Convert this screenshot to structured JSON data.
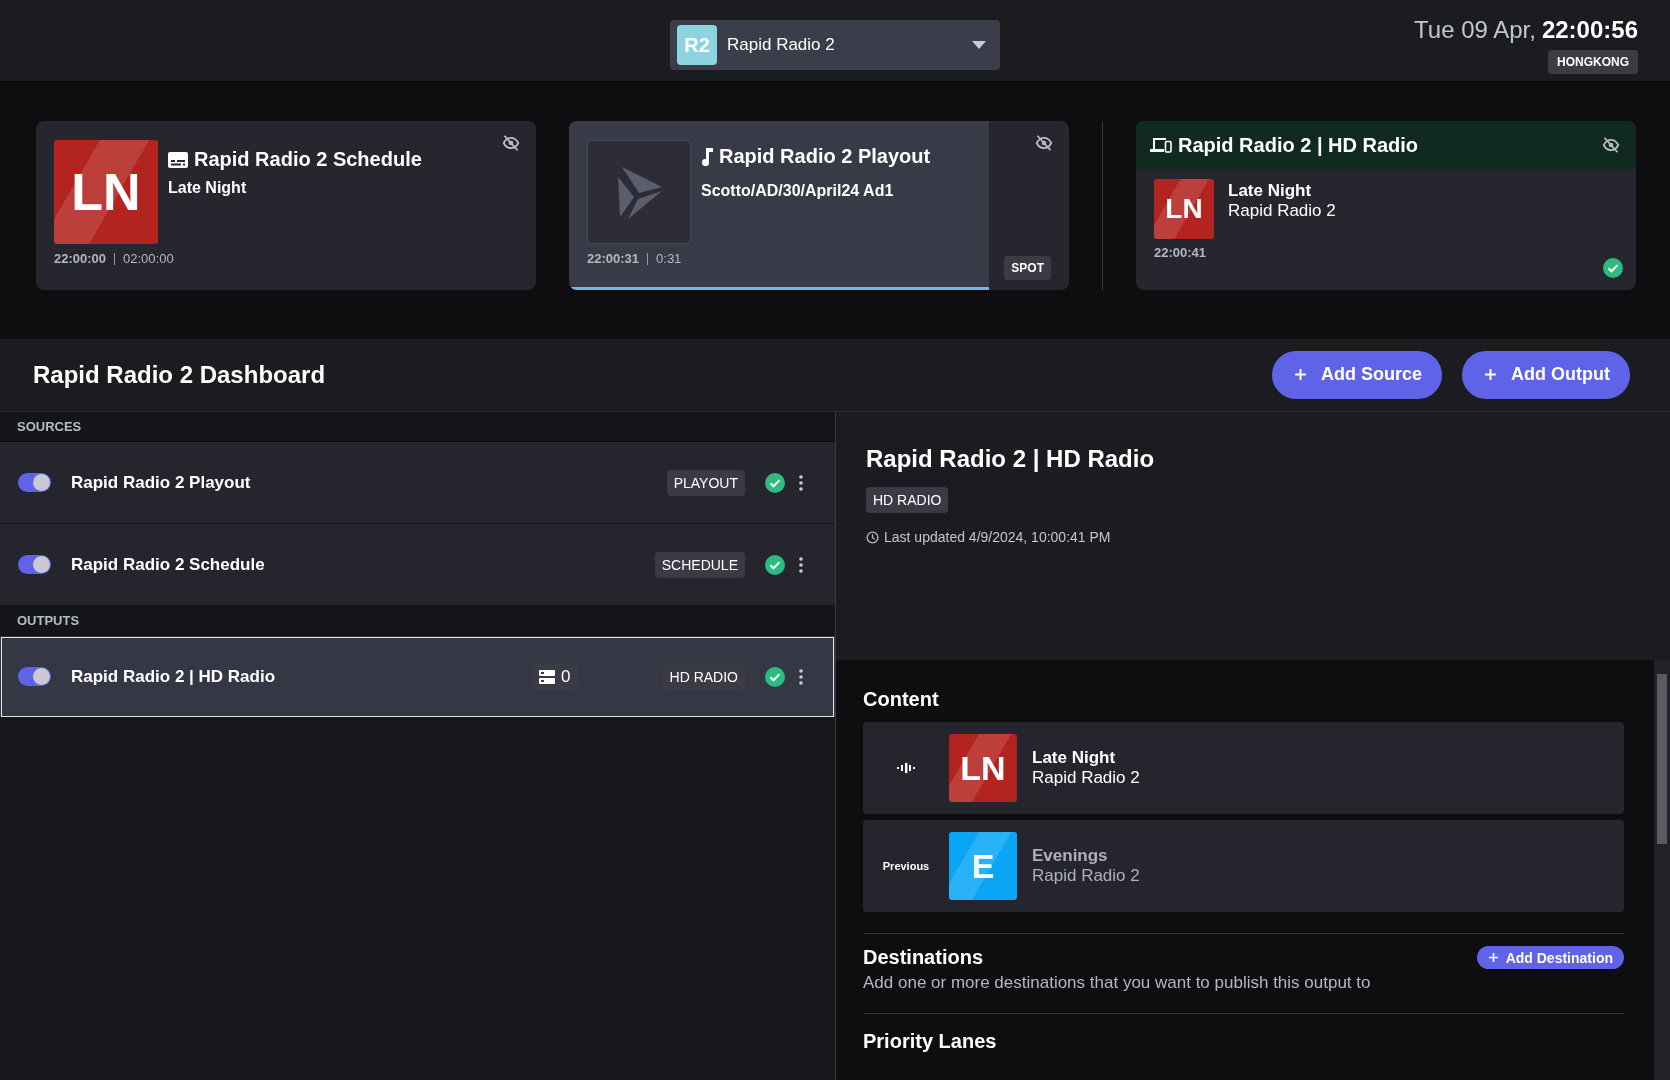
{
  "station_selector": {
    "badge": "R2",
    "name": "Rapid Radio 2"
  },
  "clock": {
    "date": "Tue 09 Apr,",
    "time": "22:00:56",
    "timezone": "HONGKONG"
  },
  "now_cards": [
    {
      "kind": "schedule",
      "art": "LN",
      "title": "Rapid Radio 2 Schedule",
      "subtitle": "Late Night",
      "start": "22:00:00",
      "duration": "02:00:00"
    },
    {
      "kind": "playout",
      "title": "Rapid Radio 2 Playout",
      "subtitle": "Scotto/AD/30/April24 Ad1",
      "start": "22:00:31",
      "duration": "0:31",
      "tag": "SPOT",
      "level": 0.84
    }
  ],
  "output_card": {
    "title": "Rapid Radio 2 | HD Radio",
    "art": "LN",
    "line1": "Late Night",
    "line2": "Rapid Radio 2",
    "time": "22:00:41",
    "ok": true
  },
  "dashboard": {
    "title": "Rapid Radio 2 Dashboard",
    "buttons": [
      "Add Source",
      "Add Output"
    ]
  },
  "sections": [
    {
      "heading": "SOURCES",
      "items": [
        {
          "name": "Rapid Radio 2 Playout",
          "on": true,
          "tag": "PLAYOUT",
          "ok": true,
          "selected": false
        },
        {
          "name": "Rapid Radio 2 Schedule",
          "on": true,
          "tag": "SCHEDULE",
          "ok": true,
          "selected": false
        }
      ]
    },
    {
      "heading": "OUTPUTS",
      "items": [
        {
          "name": "Rapid Radio 2 | HD Radio",
          "on": true,
          "count": "0",
          "tag": "HD RADIO",
          "ok": true,
          "selected": true
        }
      ]
    }
  ],
  "detail": {
    "title": "Rapid Radio 2 | HD Radio",
    "tag": "HD RADIO",
    "updated": "Last updated 4/9/2024, 10:00:41 PM",
    "content_heading": "Content",
    "content": [
      {
        "kind": "current",
        "art": "LN",
        "color": "#b3231f",
        "line1": "Late Night",
        "line2": "Rapid Radio 2"
      },
      {
        "kind": "previous",
        "label": "Previous",
        "art": "E",
        "color": "#0aa6f5",
        "line1": "Evenings",
        "line2": "Rapid Radio 2"
      }
    ],
    "destinations": {
      "heading": "Destinations",
      "button": "Add Destination",
      "description": "Add one or more destinations that you want to publish this output to"
    },
    "priority_heading": "Priority Lanes"
  }
}
